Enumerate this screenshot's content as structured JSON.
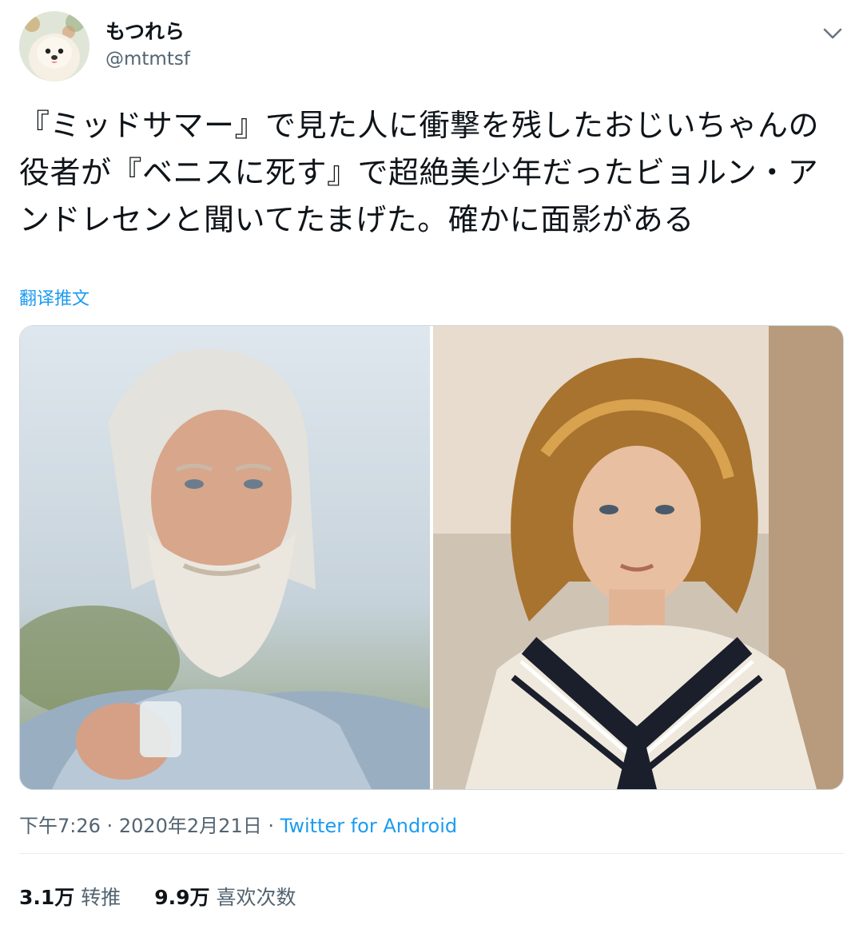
{
  "user": {
    "display_name": "もつれら",
    "handle": "@mtmtsf"
  },
  "tweet": {
    "text": "『ミッドサマー』で見た人に衝撃を残したおじいちゃんの役者が『ベニスに死す』で超絶美少年だったビョルン・アンドレセンと聞いてたまげた。確かに面影がある",
    "translate_label": "翻译推文"
  },
  "meta": {
    "time": "下午7:26",
    "separator": "·",
    "date": "2020年2月21日",
    "source": "Twitter for Android"
  },
  "stats": {
    "retweets_count": "3.1万",
    "retweets_label": "转推",
    "likes_count": "9.9万",
    "likes_label": "喜欢次数"
  },
  "icons": {
    "menu": "chevron-down-icon"
  },
  "colors": {
    "link": "#1d9bf0",
    "secondary_text": "#536471"
  }
}
